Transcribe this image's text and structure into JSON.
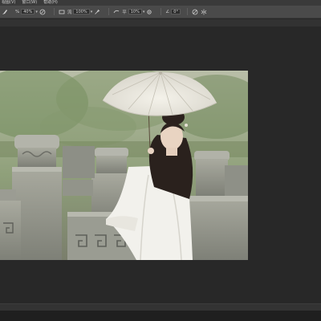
{
  "menu": {
    "items": [
      "视图(V)",
      "窗口(W)",
      "帮助(H)"
    ]
  },
  "options_bar": {
    "opacity_label": "%",
    "opacity_value": "40%",
    "flow_label": "流",
    "flow_value": "100%",
    "smooth_label": "平",
    "smooth_value": "10%",
    "angle_label": "∠",
    "angle_value": "0°"
  },
  "icons": [
    "brush-tool-icon",
    "pressure-opacity-icon",
    "airbrush-icon",
    "smoothing-gear-icon",
    "angle-icon",
    "pressure-size-icon",
    "symmetry-icon"
  ],
  "colors": {
    "menubar": "#3a3a3a",
    "options_bar": "#4a4a4a",
    "workspace": "#282828",
    "canvas_bg": "#a8b29a"
  }
}
